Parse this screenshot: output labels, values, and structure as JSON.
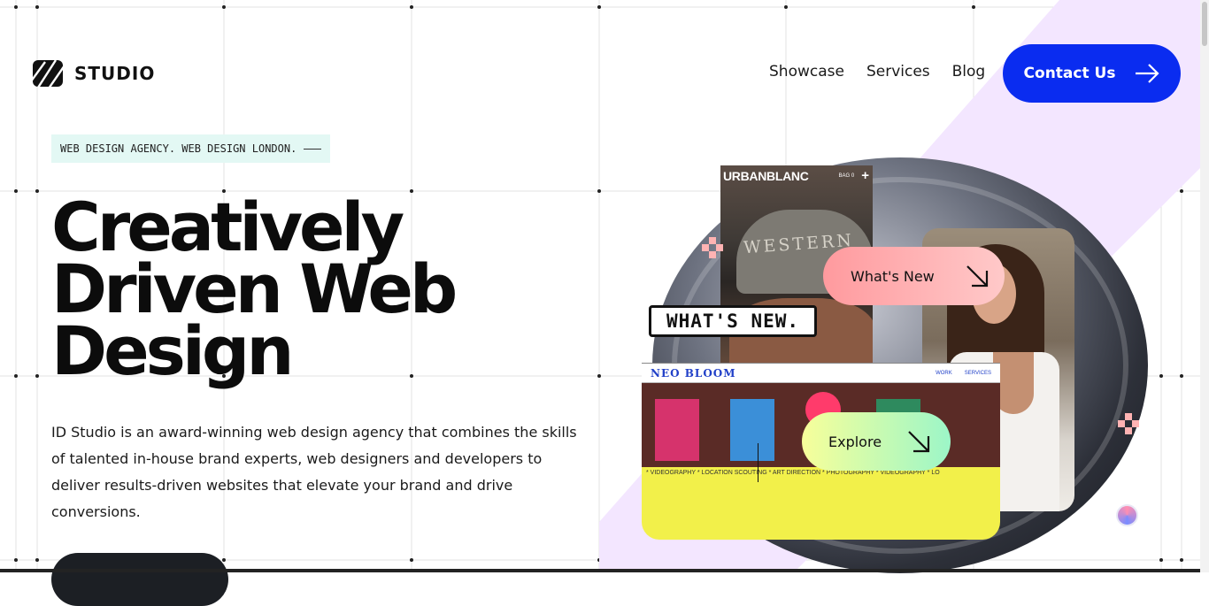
{
  "header": {
    "logo_text": "STUDIO",
    "nav": [
      "Showcase",
      "Services",
      "Blog"
    ],
    "cta_label": "Contact Us"
  },
  "hero": {
    "tagline": "WEB DESIGN AGENCY. WEB DESIGN LONDON.",
    "title_lines": [
      "Creatively",
      "Driven Web",
      "Design"
    ],
    "description": "ID Studio is an award-winning web design agency that combines the skills of talented in-house brand experts, web designers and developers to deliver results-driven websites that elevate your brand and drive conversions."
  },
  "showcase": {
    "urban_card": {
      "brand": "URBANBLANC",
      "bag": "BAG 0",
      "plus": "+",
      "cap_text": "WESTERN"
    },
    "bubble": "WHAT'S NEW.",
    "neo_card": {
      "logo": "NEO BLOOM",
      "nav": [
        "WORK",
        "SERVICES"
      ],
      "ticker": "* VIDEOGRAPHY * LOCATION SCOUTING * ART DIRECTION * PHOTOGRAPHY * VIDEOGRAPHY * LO"
    },
    "whats_new_label": "What's New",
    "explore_label": "Explore"
  },
  "colors": {
    "primary": "#0a2cf0",
    "lavender": "#f3e6ff",
    "tagline_bg": "#e3f8f4",
    "pink_pill": "#ff9a9e",
    "green_pill": "#9cf6c8",
    "neo_yellow": "#f2f04a"
  },
  "icons": [
    "arrow-right-icon",
    "arrow-down-right-icon",
    "logo-mark-icon",
    "help-avatar-icon"
  ]
}
